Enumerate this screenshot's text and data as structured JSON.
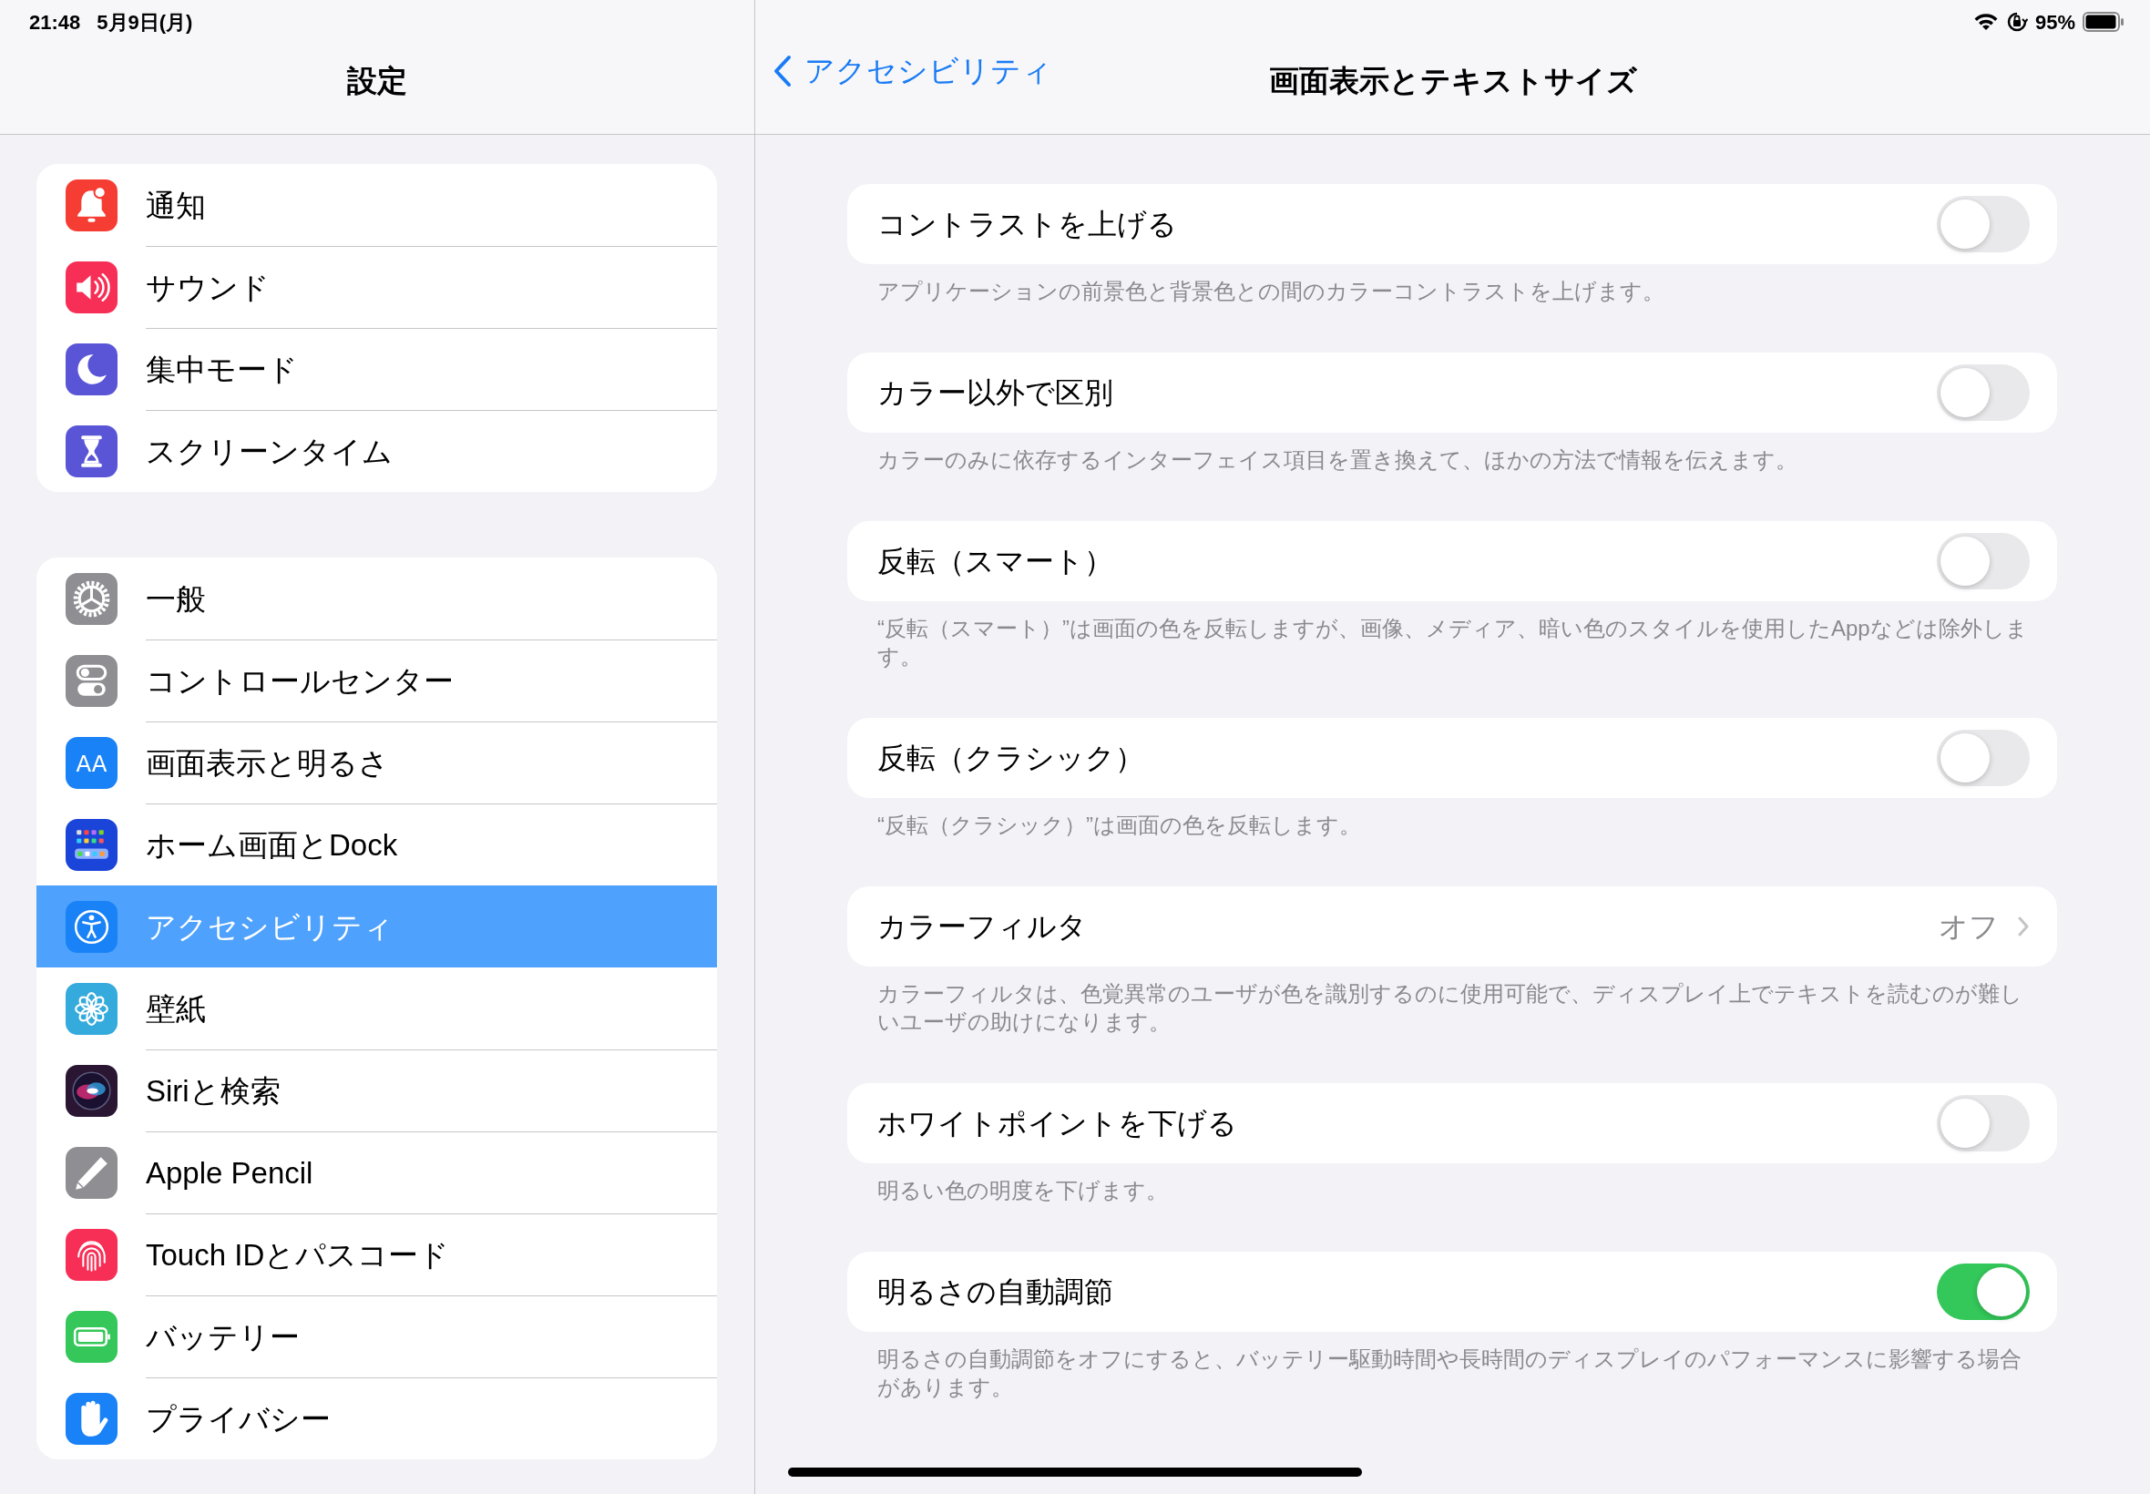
{
  "status_bar": {
    "time": "21:48",
    "date": "5月9日(月)",
    "battery": "95%"
  },
  "sidebar": {
    "title": "設定",
    "sections": [
      {
        "items": [
          {
            "label": "通知",
            "color": "#f63d33",
            "selected": false
          },
          {
            "label": "サウンド",
            "color": "#f72e55",
            "selected": false
          },
          {
            "label": "集中モード",
            "color": "#5a55d6",
            "selected": false
          },
          {
            "label": "スクリーンタイム",
            "color": "#5a55d6",
            "selected": false
          }
        ]
      },
      {
        "items": [
          {
            "label": "一般",
            "color": "#8e8e93",
            "selected": false
          },
          {
            "label": "コントロールセンター",
            "color": "#8e8e93",
            "selected": false
          },
          {
            "label": "画面表示と明るさ",
            "color": "#1a82f7",
            "selected": false,
            "icon_label": "AA"
          },
          {
            "label": "ホーム画面とDock",
            "color": "#1b45d8",
            "selected": false
          },
          {
            "label": "アクセシビリティ",
            "color": "#1a82f7",
            "selected": true
          },
          {
            "label": "壁紙",
            "color": "#35aadc",
            "selected": false
          },
          {
            "label": "Siriと検索",
            "color": "#2a1633",
            "selected": false
          },
          {
            "label": "Apple Pencil",
            "color": "#8e8e93",
            "selected": false
          },
          {
            "label": "Touch IDとパスコード",
            "color": "#f72e55",
            "selected": false
          },
          {
            "label": "バッテリー",
            "color": "#35c759",
            "selected": false
          },
          {
            "label": "プライバシー",
            "color": "#1a82f7",
            "selected": false
          }
        ]
      }
    ]
  },
  "detail": {
    "back": "アクセシビリティ",
    "title": "画面表示とテキストサイズ",
    "settings": [
      {
        "kind": "toggle",
        "label": "コントラストを上げる",
        "on": false,
        "description": "アプリケーションの前景色と背景色との間のカラーコントラストを上げます。"
      },
      {
        "kind": "toggle",
        "label": "カラー以外で区別",
        "on": false,
        "description": "カラーのみに依存するインターフェイス項目を置き換えて、ほかの方法で情報を伝えます。"
      },
      {
        "kind": "toggle",
        "label": "反転（スマート）",
        "on": false,
        "description": "“反転（スマート）”は画面の色を反転しますが、画像、メディア、暗い色のスタイルを使用したAppなどは除外します。"
      },
      {
        "kind": "toggle",
        "label": "反転（クラシック）",
        "on": false,
        "description": "“反転（クラシック）”は画面の色を反転します。"
      },
      {
        "kind": "link",
        "label": "カラーフィルタ",
        "value": "オフ",
        "description": "カラーフィルタは、色覚異常のユーザが色を識別するのに使用可能で、ディスプレイ上でテキストを読むのが難しいユーザの助けになります。"
      },
      {
        "kind": "toggle",
        "label": "ホワイトポイントを下げる",
        "on": false,
        "description": "明るい色の明度を下げます。"
      },
      {
        "kind": "toggle",
        "label": "明るさの自動調節",
        "on": true,
        "description": "明るさの自動調節をオフにすると、バッテリー駆動時間や長時間のディスプレイのパフォーマンスに影響する場合があります。"
      }
    ]
  }
}
